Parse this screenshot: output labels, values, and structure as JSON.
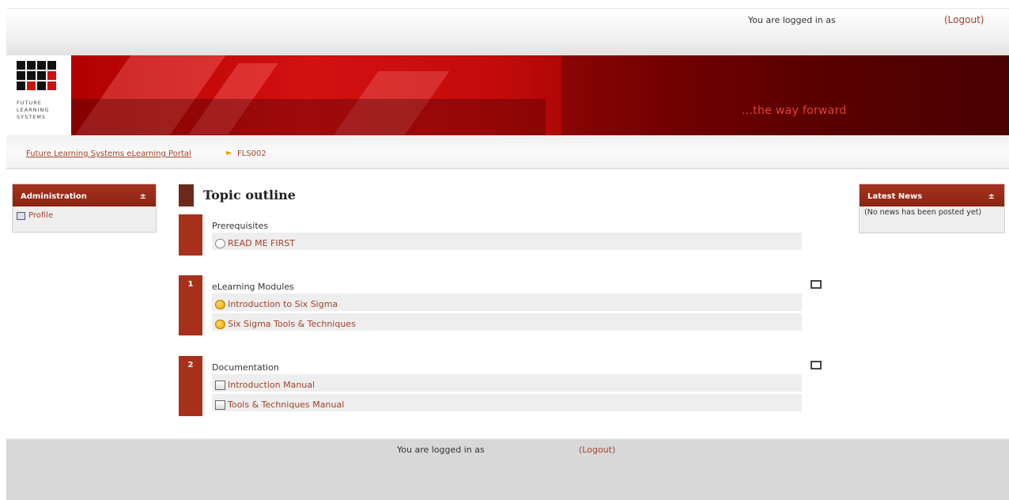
{
  "header": {
    "logged_in_text": "You are logged in as",
    "logout_label": "(Logout)"
  },
  "banner": {
    "logo_lines": [
      "FUTURE",
      "LEARNING",
      "SYSTEMS"
    ],
    "tagline": "...the way forward"
  },
  "breadcrumb": {
    "home_label": "Future Learning Systems eLearning Portal",
    "separator": "►",
    "current": "FLS002"
  },
  "admin_block": {
    "title": "Administration",
    "control": "±",
    "items": [
      {
        "label": "Profile",
        "icon": "profile-icon"
      }
    ]
  },
  "news_block": {
    "title": "Latest News",
    "control": "±",
    "body": "(No news has been posted yet)"
  },
  "outline": {
    "title": "Topic outline",
    "sections": [
      {
        "number": "",
        "name": "Prerequisites",
        "activities": [
          {
            "label": "READ ME FIRST",
            "icon": "page-icon"
          }
        ]
      },
      {
        "number": "1",
        "name": "eLearning Modules",
        "activities": [
          {
            "label": "Introduction to Six Sigma",
            "icon": "scorm-icon"
          },
          {
            "label": "Six Sigma Tools & Techniques",
            "icon": "scorm-icon"
          }
        ]
      },
      {
        "number": "2",
        "name": "Documentation",
        "activities": [
          {
            "label": "Introduction Manual",
            "icon": "resource-icon"
          },
          {
            "label": "Tools & Techniques Manual",
            "icon": "resource-icon"
          }
        ]
      }
    ]
  },
  "footer": {
    "logged_in_text": "You are logged in as",
    "logout_label": "(Logout)"
  },
  "colors": {
    "accent": "#a3432a",
    "block_header": "#9a2b17",
    "banner_red": "#c40b0b"
  }
}
